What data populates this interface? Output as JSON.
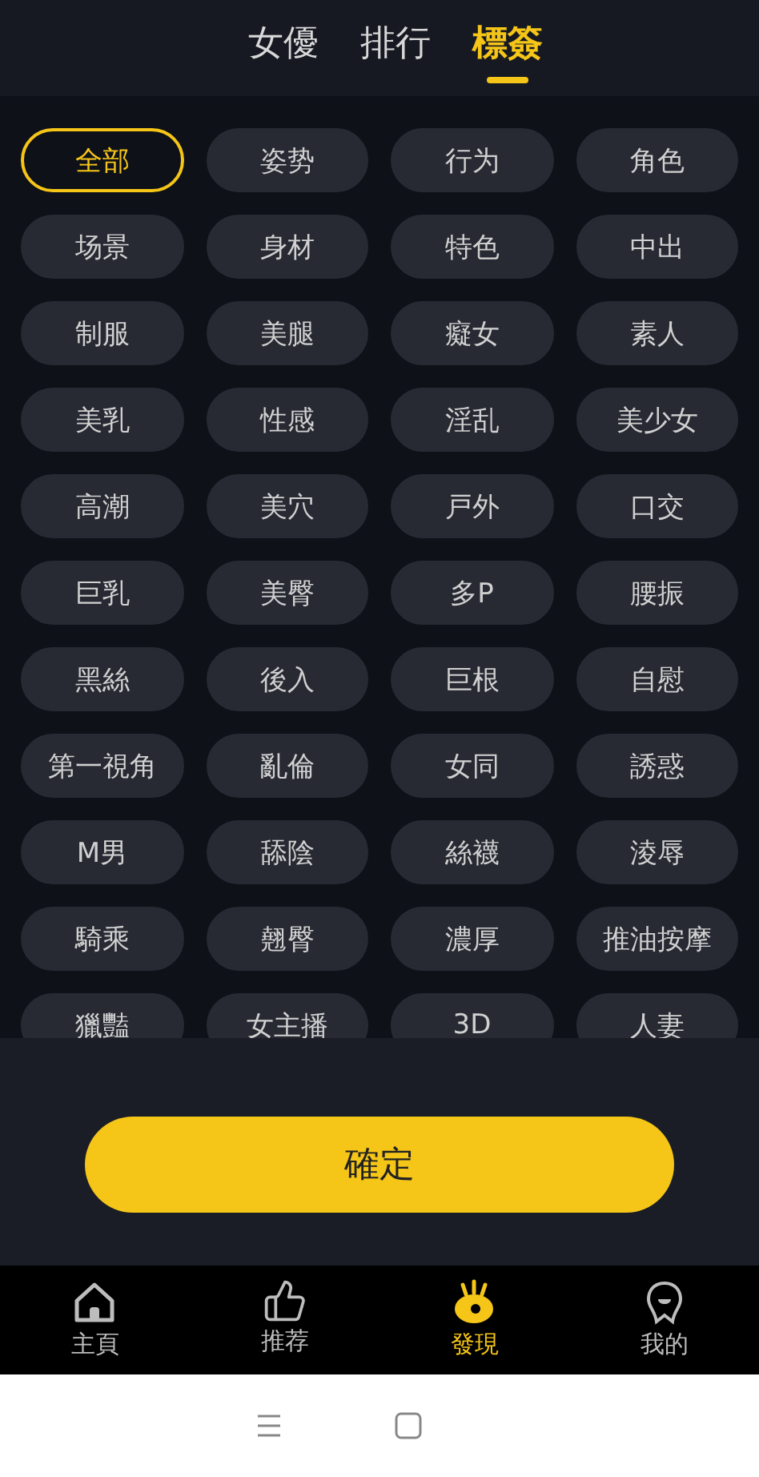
{
  "tabs": [
    {
      "label": "女優",
      "selected": false
    },
    {
      "label": "排行",
      "selected": false
    },
    {
      "label": "標簽",
      "selected": true
    }
  ],
  "tags": [
    {
      "label": "全部",
      "selected": true
    },
    {
      "label": "姿势",
      "selected": false
    },
    {
      "label": "行为",
      "selected": false
    },
    {
      "label": "角色",
      "selected": false
    },
    {
      "label": "场景",
      "selected": false
    },
    {
      "label": "身材",
      "selected": false
    },
    {
      "label": "特色",
      "selected": false
    },
    {
      "label": "中出",
      "selected": false
    },
    {
      "label": "制服",
      "selected": false
    },
    {
      "label": "美腿",
      "selected": false
    },
    {
      "label": "癡女",
      "selected": false
    },
    {
      "label": "素人",
      "selected": false
    },
    {
      "label": "美乳",
      "selected": false
    },
    {
      "label": "性感",
      "selected": false
    },
    {
      "label": "淫乱",
      "selected": false
    },
    {
      "label": "美少女",
      "selected": false
    },
    {
      "label": "高潮",
      "selected": false
    },
    {
      "label": "美穴",
      "selected": false
    },
    {
      "label": "戸外",
      "selected": false
    },
    {
      "label": "口交",
      "selected": false
    },
    {
      "label": "巨乳",
      "selected": false
    },
    {
      "label": "美臀",
      "selected": false
    },
    {
      "label": "多P",
      "selected": false
    },
    {
      "label": "腰振",
      "selected": false
    },
    {
      "label": "黑絲",
      "selected": false
    },
    {
      "label": "後入",
      "selected": false
    },
    {
      "label": "巨根",
      "selected": false
    },
    {
      "label": "自慰",
      "selected": false
    },
    {
      "label": "第一視角",
      "selected": false
    },
    {
      "label": "亂倫",
      "selected": false
    },
    {
      "label": "女同",
      "selected": false
    },
    {
      "label": "誘惑",
      "selected": false
    },
    {
      "label": "M男",
      "selected": false
    },
    {
      "label": "舔陰",
      "selected": false
    },
    {
      "label": "絲襪",
      "selected": false
    },
    {
      "label": "淩辱",
      "selected": false
    },
    {
      "label": "騎乘",
      "selected": false
    },
    {
      "label": "翹臀",
      "selected": false
    },
    {
      "label": "濃厚",
      "selected": false
    },
    {
      "label": "推油按摩",
      "selected": false
    },
    {
      "label": "獵豔",
      "selected": false
    },
    {
      "label": "女主播",
      "selected": false
    },
    {
      "label": "3D",
      "selected": false
    },
    {
      "label": "人妻",
      "selected": false
    }
  ],
  "confirm_button": "確定",
  "bottom_nav": [
    {
      "label": "主頁",
      "kind": "home",
      "selected": false
    },
    {
      "label": "推荐",
      "kind": "like",
      "selected": false
    },
    {
      "label": "發現",
      "kind": "discover",
      "selected": true
    },
    {
      "label": "我的",
      "kind": "me",
      "selected": false
    }
  ]
}
